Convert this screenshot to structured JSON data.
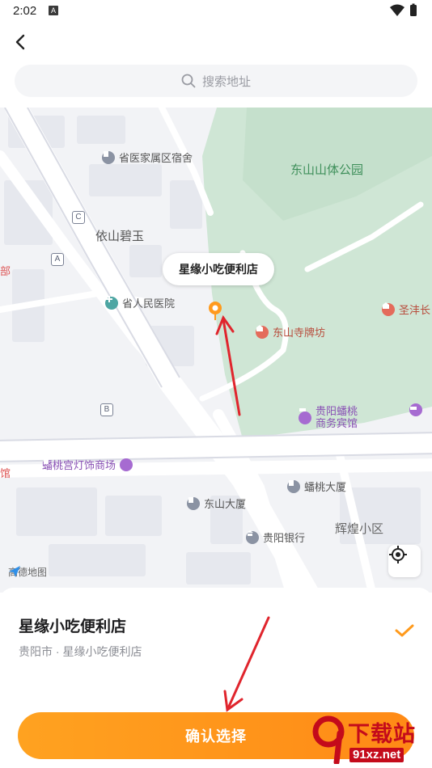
{
  "status_bar": {
    "time": "2:02",
    "notification_glyph": "A"
  },
  "search": {
    "placeholder": "搜索地址"
  },
  "map": {
    "callout_label": "星缘小吃便利店",
    "brand": "高德地图",
    "labels": {
      "park": "东山山体公园",
      "yishan": "依山碧玉",
      "huihuang": "辉煌小区"
    },
    "pois": {
      "dormitory": "省医家属区宿舍",
      "hospital": "省人民医院",
      "temple_gate": "东山寺牌坊",
      "hotel_line1": "贵阳蟠桃",
      "hotel_line2": "商务宾馆",
      "lantern_mall": "蟠桃宫灯饰商场",
      "pantao_building": "蟠桃大厦",
      "dongshan_building": "东山大厦",
      "bank": "贵阳银行",
      "shengfeng": "圣沣长"
    },
    "metro_letters": {
      "c": "C",
      "a": "A",
      "b": "B"
    },
    "edge_fragments": {
      "bu": "部",
      "guan": "馆"
    }
  },
  "selection": {
    "name": "星缘小吃便利店",
    "address": "贵阳市 · 星缘小吃便利店"
  },
  "confirm_label": "确认选择",
  "watermark": {
    "text": "下载站",
    "url": "91xz.net"
  },
  "colors": {
    "accent": "#ff9a1c",
    "park_green": "#cfe6d5",
    "annotation_red": "#e0252d",
    "watermark_red": "#c40b1b"
  }
}
